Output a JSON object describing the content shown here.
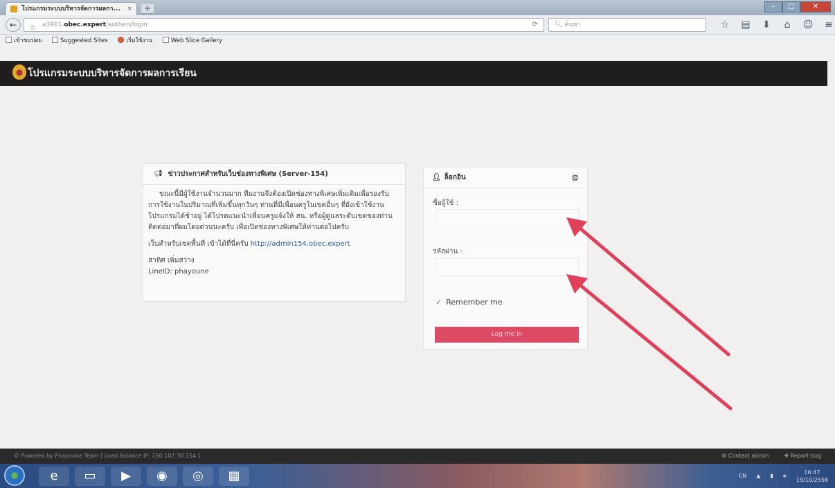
{
  "browser": {
    "tab_title": "โปรแกรมระบบบริหารจัดการผลกา...",
    "tab_close": "×",
    "new_tab": "+",
    "url_host": "obec.expert",
    "url_prefix": "a3901.",
    "url_path": "/authen/login",
    "search_placeholder": "ค้นหา",
    "bookmarks": [
      "เข้าชมบ่อย",
      "Suggested Sites",
      "เริ่มใช้งาน",
      "Web Slice Gallery"
    ]
  },
  "app": {
    "title": "โปรแกรมระบบบริหารจัดการผลการเรียน"
  },
  "announcement": {
    "title": "ข่าวประกาศสำหรับเว็บช่องทางพิเศษ (Server-154)",
    "body": "ขณะนี้มีผู้ใช้งานจำนวนมาก ทีมงานจึงต้องเปิดช่องทางพิเศษเพิ่มเติมเพื่อรองรับการใช้งานในปริมาณที่เพิ่มขึ้นทุกวันๆ ท่านที่มีเพื่อนครูในเขตอื่นๆ ที่ยังเข้าใช้งานโปรแกรมได้ช้าอยู่ ได้โปรดแนะนำเพื่อนครูแจ้งให้ สน. หรือผู้ดูแลระดับเขตของท่าน ติดต่อมาที่ผมโดยด่วนนะครับ เพื่อเปิดช่องทางพิเศษให้ท่านต่อไปครับ",
    "link_text": "เว็บสำหรับเขตพื้นที่ เข้าได้ที่นี่ครับ",
    "link_url": "http://admin154.obec.expert",
    "signature_name": "สาทิศ เพิ่มสว่าง",
    "signature_line": "LineID: phayoune"
  },
  "login": {
    "title": "ล็อกอิน",
    "username_label": "ชื่อผู้ใช้ :",
    "username_value": "",
    "password_label": "รหัสผ่าน :",
    "password_value": "",
    "remember_label": "Remember me",
    "submit_label": "Log me in"
  },
  "footer": {
    "credit": "© Powered by Phayoune Team [ Load Balance IP: 150.107.30.154 ]",
    "contact_admin": "Contact admin",
    "report_bug": "Report bug"
  },
  "taskbar": {
    "lang": "EN",
    "time": "16:47",
    "date": "19/10/2558"
  },
  "colors": {
    "header_bg": "#1f1d1e",
    "login_button": "#dc4a65",
    "annotation_arrow": "#e0405a"
  }
}
